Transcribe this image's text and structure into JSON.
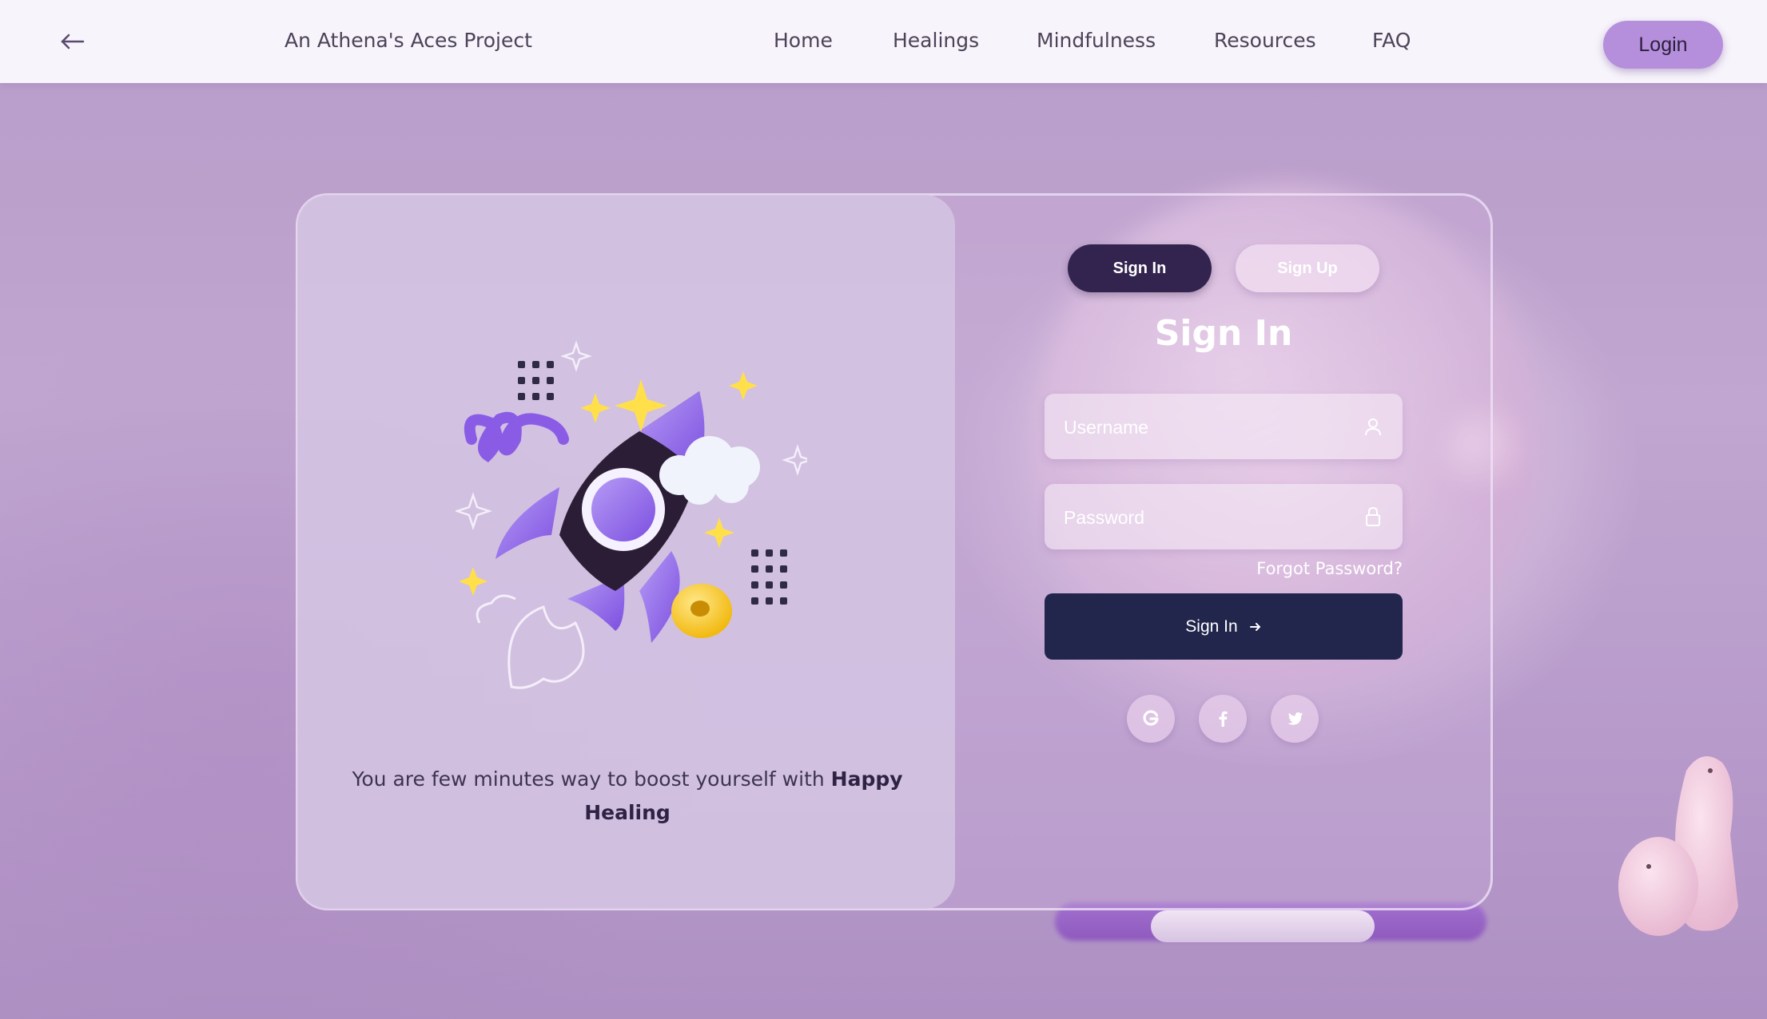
{
  "header": {
    "back_icon": "arrow-left-icon",
    "brand": "An Athena's Aces Project",
    "nav": [
      "Home",
      "Healings",
      "Mindfulness",
      "Resources",
      "FAQ"
    ],
    "login_label": "Login"
  },
  "illustration": {
    "icon": "rocket-illustration"
  },
  "tagline": {
    "text": "You are few minutes way to boost yourself with",
    "emphasis": "Happy Healing"
  },
  "auth": {
    "tab_signin": "Sign In",
    "tab_signup": "Sign Up",
    "title": "Sign In",
    "username_placeholder": "Username",
    "password_placeholder": "Password",
    "forgot": "Forgot Password?",
    "submit": "Sign In",
    "social": [
      "google-icon",
      "facebook-icon",
      "twitter-icon"
    ]
  },
  "colors": {
    "accent": "#b58fdc",
    "dark": "#33244f",
    "button": "#22264d"
  }
}
